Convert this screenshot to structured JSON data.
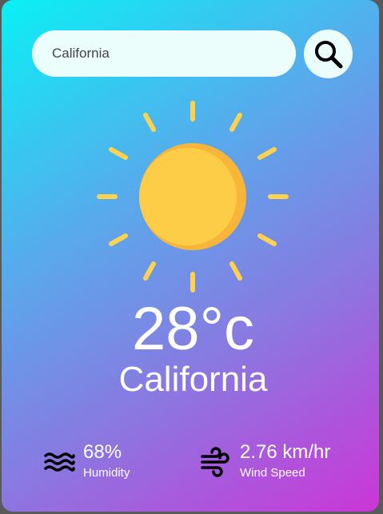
{
  "search": {
    "value": "California",
    "placeholder": ""
  },
  "search_button": {
    "icon": "search-icon"
  },
  "weather": {
    "icon": "sun-icon",
    "temperature": "28°c",
    "city": "California"
  },
  "details": {
    "humidity": {
      "icon": "waves-icon",
      "value": "68%",
      "label": "Humidity"
    },
    "wind": {
      "icon": "wind-icon",
      "value": "2.76 km/hr",
      "label": "Wind Speed"
    }
  },
  "colors": {
    "gradient_start": "#0af0f5",
    "gradient_end": "#cc36d8",
    "field_background": "#ebfefb",
    "sun": "#fdcd48",
    "sun_shade": "#f7b53a",
    "text": "#ffffff"
  }
}
